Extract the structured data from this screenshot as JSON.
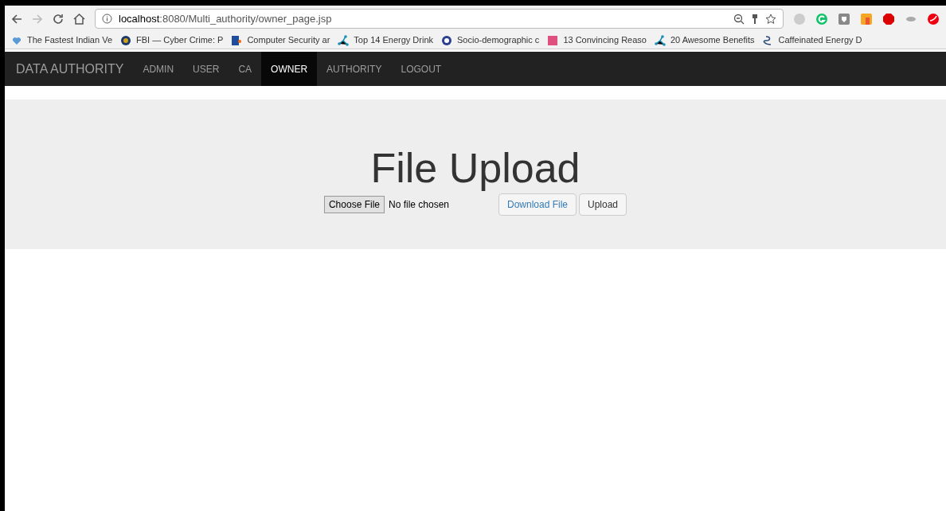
{
  "browser": {
    "url_host": "localhost",
    "url_rest": ":8080/Multi_authority/owner_page.jsp",
    "bookmarks": [
      {
        "label": "The Fastest Indian Ve"
      },
      {
        "label": "FBI — Cyber Crime: P"
      },
      {
        "label": "Computer Security ar"
      },
      {
        "label": "Top 14 Energy Drink"
      },
      {
        "label": "Socio-demographic c"
      },
      {
        "label": "13 Convincing Reaso"
      },
      {
        "label": "20 Awesome Benefits"
      },
      {
        "label": "Caffeinated Energy D"
      }
    ]
  },
  "navbar": {
    "brand": "DATA AUTHORITY",
    "items": [
      {
        "label": "ADMIN",
        "selected": false
      },
      {
        "label": "USER",
        "selected": false
      },
      {
        "label": "CA",
        "selected": false
      },
      {
        "label": "OWNER",
        "selected": true
      },
      {
        "label": "AUTHORITY",
        "selected": false
      },
      {
        "label": "LOGOUT",
        "selected": false
      }
    ]
  },
  "main": {
    "title": "File Upload",
    "choose_button": "Choose File",
    "file_status": "No file chosen",
    "download_button": "Download File",
    "upload_button": "Upload"
  }
}
